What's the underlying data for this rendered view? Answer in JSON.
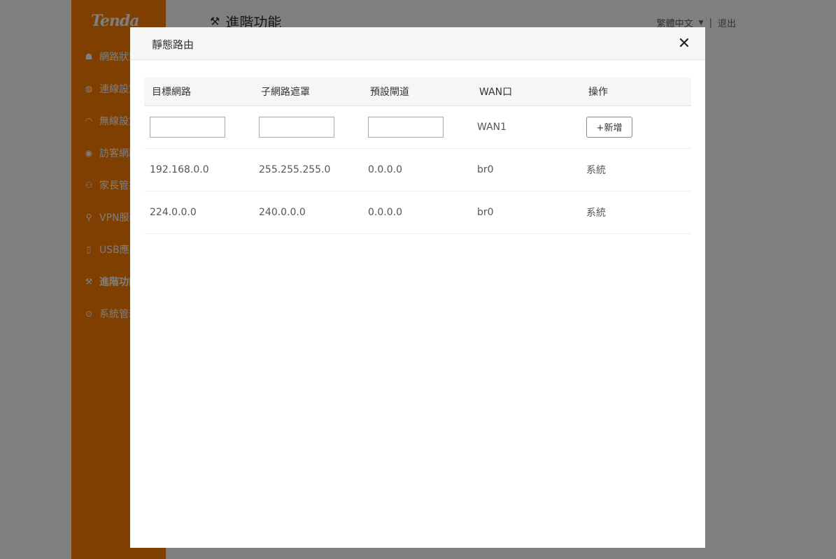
{
  "brand": {
    "logo_text": "Tenda",
    "accent_color": "#ff7f00"
  },
  "sidebar": {
    "items": [
      {
        "label": "網路狀態",
        "icon": "router-icon"
      },
      {
        "label": "連線設定",
        "icon": "globe-icon"
      },
      {
        "label": "無線設定",
        "icon": "wifi-icon"
      },
      {
        "label": "訪客網路",
        "icon": "location-icon"
      },
      {
        "label": "家長管控",
        "icon": "family-icon"
      },
      {
        "label": "VPN服務",
        "icon": "vpn-icon"
      },
      {
        "label": "USB應用",
        "icon": "usb-icon"
      },
      {
        "label": "進階功能",
        "icon": "wrench-icon",
        "active": true
      },
      {
        "label": "系統管理",
        "icon": "gear-icon"
      }
    ]
  },
  "header": {
    "title": "進階功能",
    "language": "繁體中文",
    "separator": "|",
    "logout": "退出"
  },
  "modal": {
    "title": "靜態路由",
    "close_glyph": "✕",
    "columns": [
      "目標網路",
      "子網路遮罩",
      "預設閘道",
      "WAN口",
      "操作"
    ],
    "new_row": {
      "destination_value": "",
      "mask_value": "",
      "gateway_value": "",
      "wan": "WAN1",
      "add_label": "+新增"
    },
    "rows": [
      {
        "destination": "192.168.0.0",
        "mask": "255.255.255.0",
        "gateway": "0.0.0.0",
        "wan": "br0",
        "action": "系統"
      },
      {
        "destination": "224.0.0.0",
        "mask": "240.0.0.0",
        "gateway": "0.0.0.0",
        "wan": "br0",
        "action": "系統"
      }
    ]
  }
}
